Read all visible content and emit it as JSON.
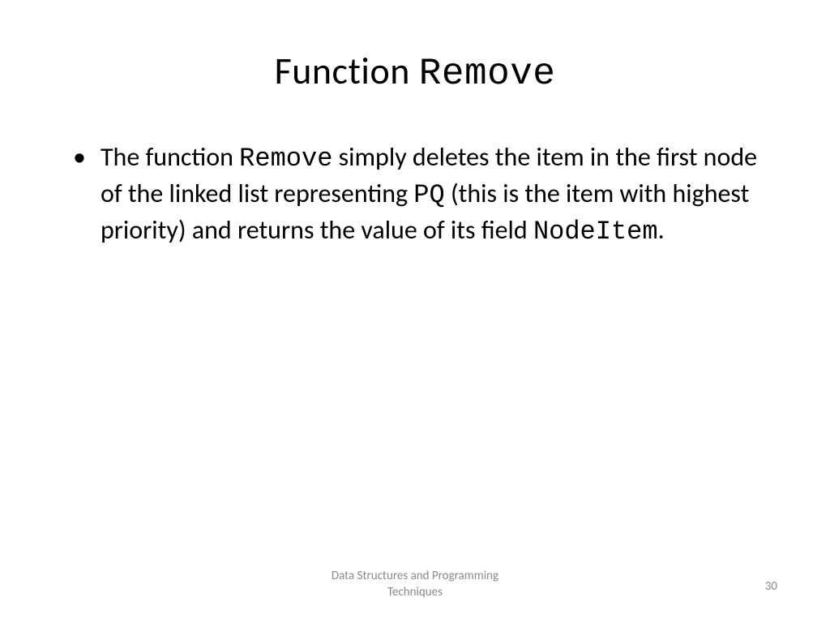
{
  "title": {
    "prefix": "Function ",
    "code": "Remove"
  },
  "bullet": {
    "t1": "The function ",
    "c1": "Remove",
    "t2": " simply deletes the item in the first node of the linked list representing ",
    "c2": "PQ",
    "t3": " (this is the item with highest priority) and returns the value of its field ",
    "c3": "NodeItem",
    "t4": "."
  },
  "footer": {
    "line1": "Data Structures and Programming",
    "line2": "Techniques"
  },
  "page_number": "30"
}
